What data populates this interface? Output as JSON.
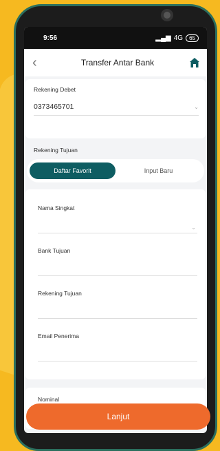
{
  "status": {
    "time": "9:56",
    "network": "4G",
    "battery": "65"
  },
  "header": {
    "title": "Transfer Antar Bank"
  },
  "debet": {
    "label": "Rekening Debet",
    "value": "0373465701"
  },
  "tujuan": {
    "label": "Rekening Tujuan"
  },
  "toggle": {
    "favorit": "Daftar Favorit",
    "baru": "Input Baru",
    "active": "favorit"
  },
  "form": {
    "fields": [
      {
        "label": "Nama Singkat"
      },
      {
        "label": "Bank Tujuan"
      },
      {
        "label": "Rekening Tujuan"
      },
      {
        "label": "Email Penerima"
      }
    ]
  },
  "nominal": {
    "label": "Nominal"
  },
  "cta": {
    "label": "Lanjut"
  },
  "colors": {
    "accent": "#0e5d62",
    "cta": "#ee6a2c",
    "background": "#f6b920"
  },
  "icons": {
    "back": "chevron-left-icon",
    "home": "home-icon",
    "dropdown": "chevron-down-icon"
  }
}
